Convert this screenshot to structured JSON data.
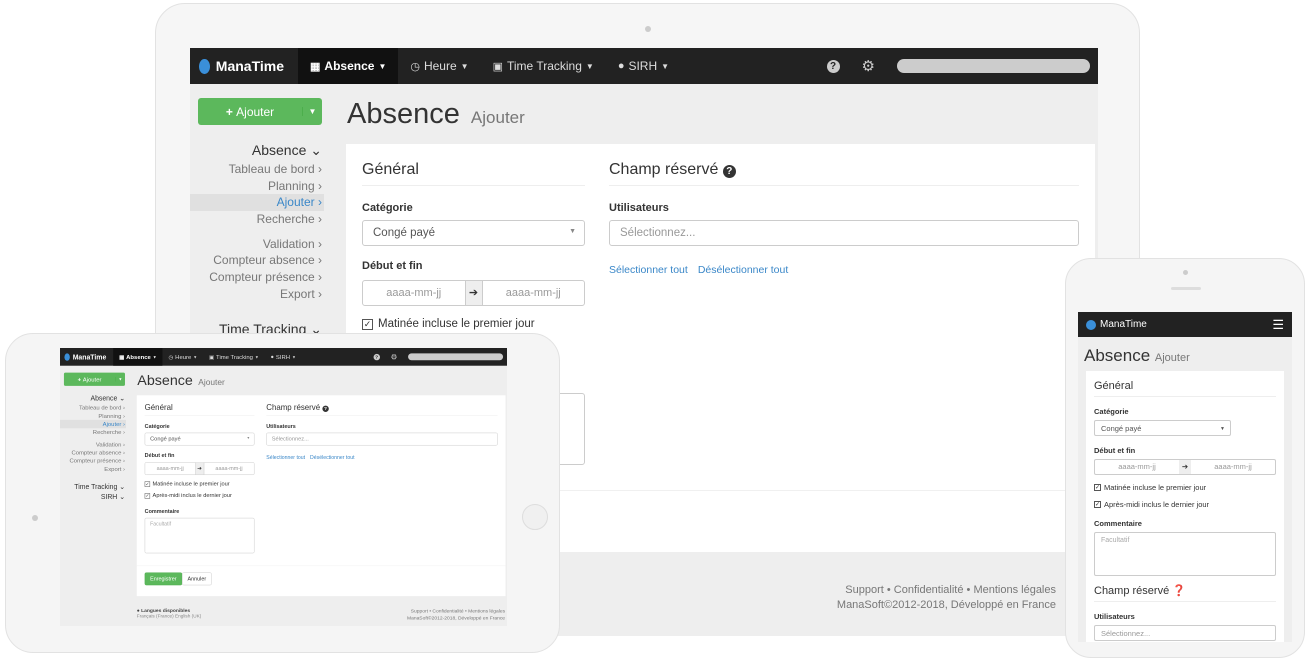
{
  "brand": "ManaTime",
  "accent": "#5cb85c",
  "link_color": "#3a87c8",
  "nav": {
    "items": [
      {
        "label": "Absence",
        "icon": "calendar-icon",
        "active": true
      },
      {
        "label": "Heure",
        "icon": "clock-icon"
      },
      {
        "label": "Time Tracking",
        "icon": "badge-icon"
      },
      {
        "label": "SIRH",
        "icon": "globe-icon"
      }
    ],
    "help_icon": "question-circle-icon",
    "settings_icon": "gear-icon"
  },
  "add_button": "Ajouter",
  "page": {
    "title": "Absence",
    "subtitle": "Ajouter"
  },
  "sidebar": {
    "groups": [
      {
        "label": "Absence",
        "items": [
          "Tableau de bord",
          "Planning",
          "Ajouter",
          "Recherche"
        ],
        "items2": [
          "Validation",
          "Compteur absence",
          "Compteur présence",
          "Export"
        ]
      },
      {
        "label": "Time Tracking"
      },
      {
        "label": "SIRH"
      }
    ],
    "current": "Ajouter"
  },
  "form": {
    "general": "Général",
    "category_label": "Catégorie",
    "category_value": "Congé payé",
    "dates_label": "Début et fin",
    "date_placeholder": "aaaa-mm-jj",
    "morning": "Matinée incluse le premier jour",
    "afternoon": "Après-midi inclus le dernier jour",
    "comment_label": "Commentaire",
    "comment_placeholder": "Facultatif",
    "reserved": "Champ réservé",
    "users_label": "Utilisateurs",
    "users_placeholder": "Sélectionnez...",
    "select_all": "Sélectionner tout",
    "deselect_all": "Désélectionner tout",
    "save": "Enregistrer",
    "cancel": "Annuler"
  },
  "footer": {
    "languages_label": "Langues disponibles",
    "languages": "Français (France)   English (UK)",
    "links": "Support • Confidentialité • Mentions légales",
    "copyright": "ManaSoft©2012-2018, Développé en France"
  }
}
